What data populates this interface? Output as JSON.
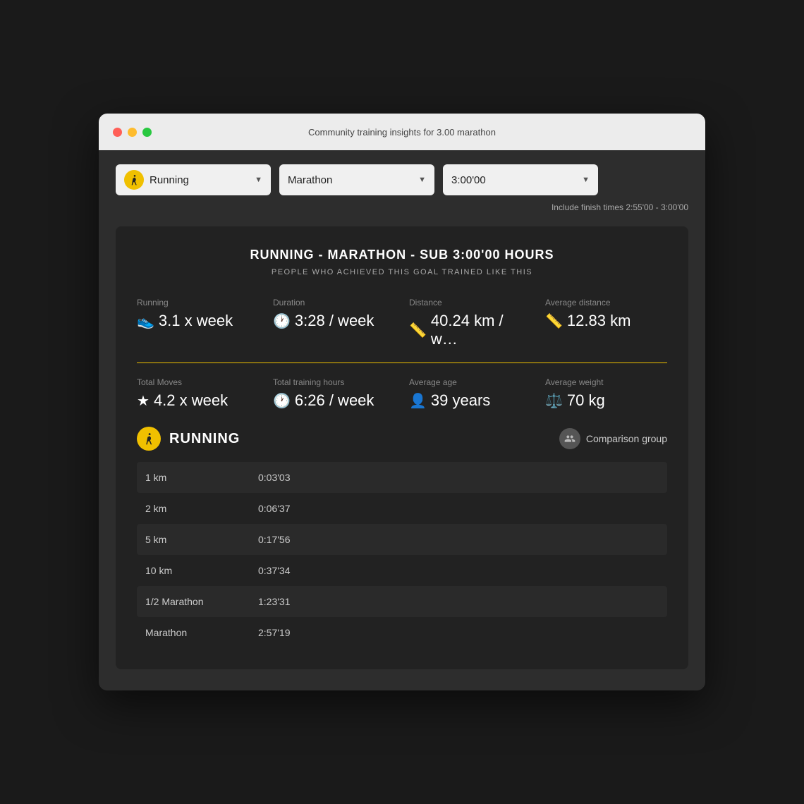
{
  "window": {
    "title": "Community training insights for 3.00 marathon"
  },
  "dropdowns": {
    "sport": {
      "label": "Running",
      "icon": "🏃"
    },
    "event": {
      "label": "Marathon"
    },
    "time": {
      "label": "3:00'00"
    },
    "finish_note": "Include finish times 2:55'00 - 3:00'00"
  },
  "section": {
    "title": "RUNNING - MARATHON - SUB 3:00'00 HOURS",
    "subtitle": "PEOPLE WHO ACHIEVED THIS GOAL TRAINED LIKE THIS"
  },
  "stats_top": [
    {
      "label": "Running",
      "value": "3.1 x week",
      "icon": "shoe",
      "icon_color": "yellow"
    },
    {
      "label": "Duration",
      "value": "3:28 / week",
      "icon": "clock",
      "icon_color": "yellow"
    },
    {
      "label": "Distance",
      "value": "40.24 km / w…",
      "icon": "ruler",
      "icon_color": "yellow"
    },
    {
      "label": "Average distance",
      "value": "12.83 km",
      "icon": "ruler",
      "icon_color": "yellow"
    }
  ],
  "stats_bottom": [
    {
      "label": "Total Moves",
      "value": "4.2 x week",
      "icon": "star",
      "icon_color": "white"
    },
    {
      "label": "Total training hours",
      "value": "6:26 / week",
      "icon": "clock_gray",
      "icon_color": "gray"
    },
    {
      "label": "Average age",
      "value": "39 years",
      "icon": "person",
      "icon_color": "gray"
    },
    {
      "label": "Average weight",
      "value": "70 kg",
      "icon": "weight",
      "icon_color": "gray"
    }
  ],
  "running_section": {
    "title": "RUNNING",
    "comparison_label": "Comparison group",
    "rows": [
      {
        "distance": "1 km",
        "time": "0:03'03"
      },
      {
        "distance": "2 km",
        "time": "0:06'37"
      },
      {
        "distance": "5 km",
        "time": "0:17'56"
      },
      {
        "distance": "10 km",
        "time": "0:37'34"
      },
      {
        "distance": "1/2 Marathon",
        "time": "1:23'31"
      },
      {
        "distance": "Marathon",
        "time": "2:57'19"
      }
    ]
  }
}
